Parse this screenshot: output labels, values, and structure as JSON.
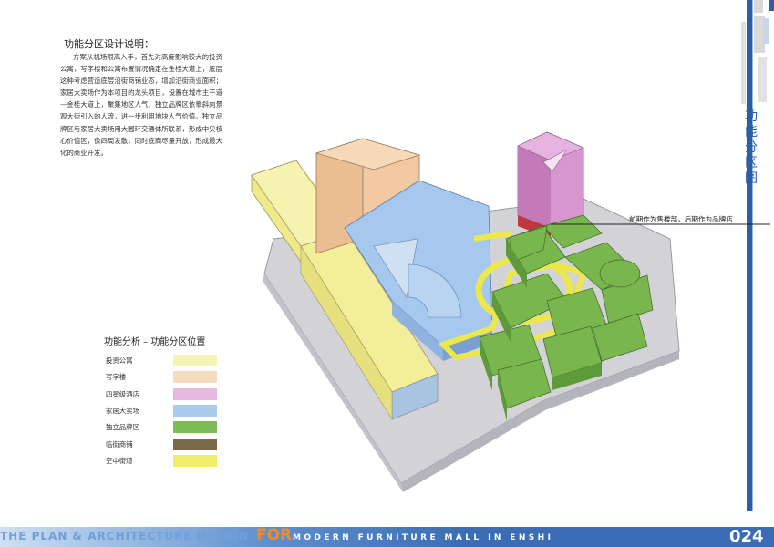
{
  "page": {
    "vertical_title": "功能分区图",
    "page_number": "024"
  },
  "description": {
    "heading": "功能分区设计说明：",
    "body": "方案从机场限高入手，首先对高度影响较大的投资公寓，写字楼和公寓布置情况确定在金桂大道上，底层这种考虑营造底层沿街商铺业态，增加沿街商业面积；家居大卖场作为本项目的龙头项目，设置在城市主干道—金桂大道上，聚集地区人气，独立品牌区依靠斜向景观大街引入的人流，进一步利用地块人气价值。独立品牌区与家居大卖场用大圆环交通体所联系，形成中央核心价值区，像四周发散，同时底商尽量开放，形成最大化的商业开发。"
  },
  "legend": {
    "title": "功能分析 – 功能分区位置",
    "items": [
      {
        "label": "投资公寓",
        "color": "#f6f3b6"
      },
      {
        "label": "写字楼",
        "color": "#f5dcc0"
      },
      {
        "label": "四星级酒店",
        "color": "#e7b8df"
      },
      {
        "label": "家居大卖场",
        "color": "#a9ccee"
      },
      {
        "label": "独立品牌区",
        "color": "#7ebb57"
      },
      {
        "label": "临街商铺",
        "color": "#7a6a48"
      },
      {
        "label": "空中街道",
        "color": "#f1ee6a"
      }
    ]
  },
  "annotation": {
    "text": "前期作为售楼部，后期作为品牌店"
  },
  "footer": {
    "left": "THE PLAN & ARCHITECTURE DESIGN",
    "for": "FOR",
    "right": "MODERN FURNITURE MALL IN ENSHI"
  },
  "colors": {
    "apartment": "#f3ee9a",
    "office": "#f2c9a0",
    "hotel": "#d896d0",
    "mall": "#a6c8ee",
    "brand": "#79b64e",
    "street_shops": "#7a6a48",
    "sky_street": "#ece84c",
    "accent_blue": "#2a5fa6",
    "footer_band": "#3a6db5"
  }
}
